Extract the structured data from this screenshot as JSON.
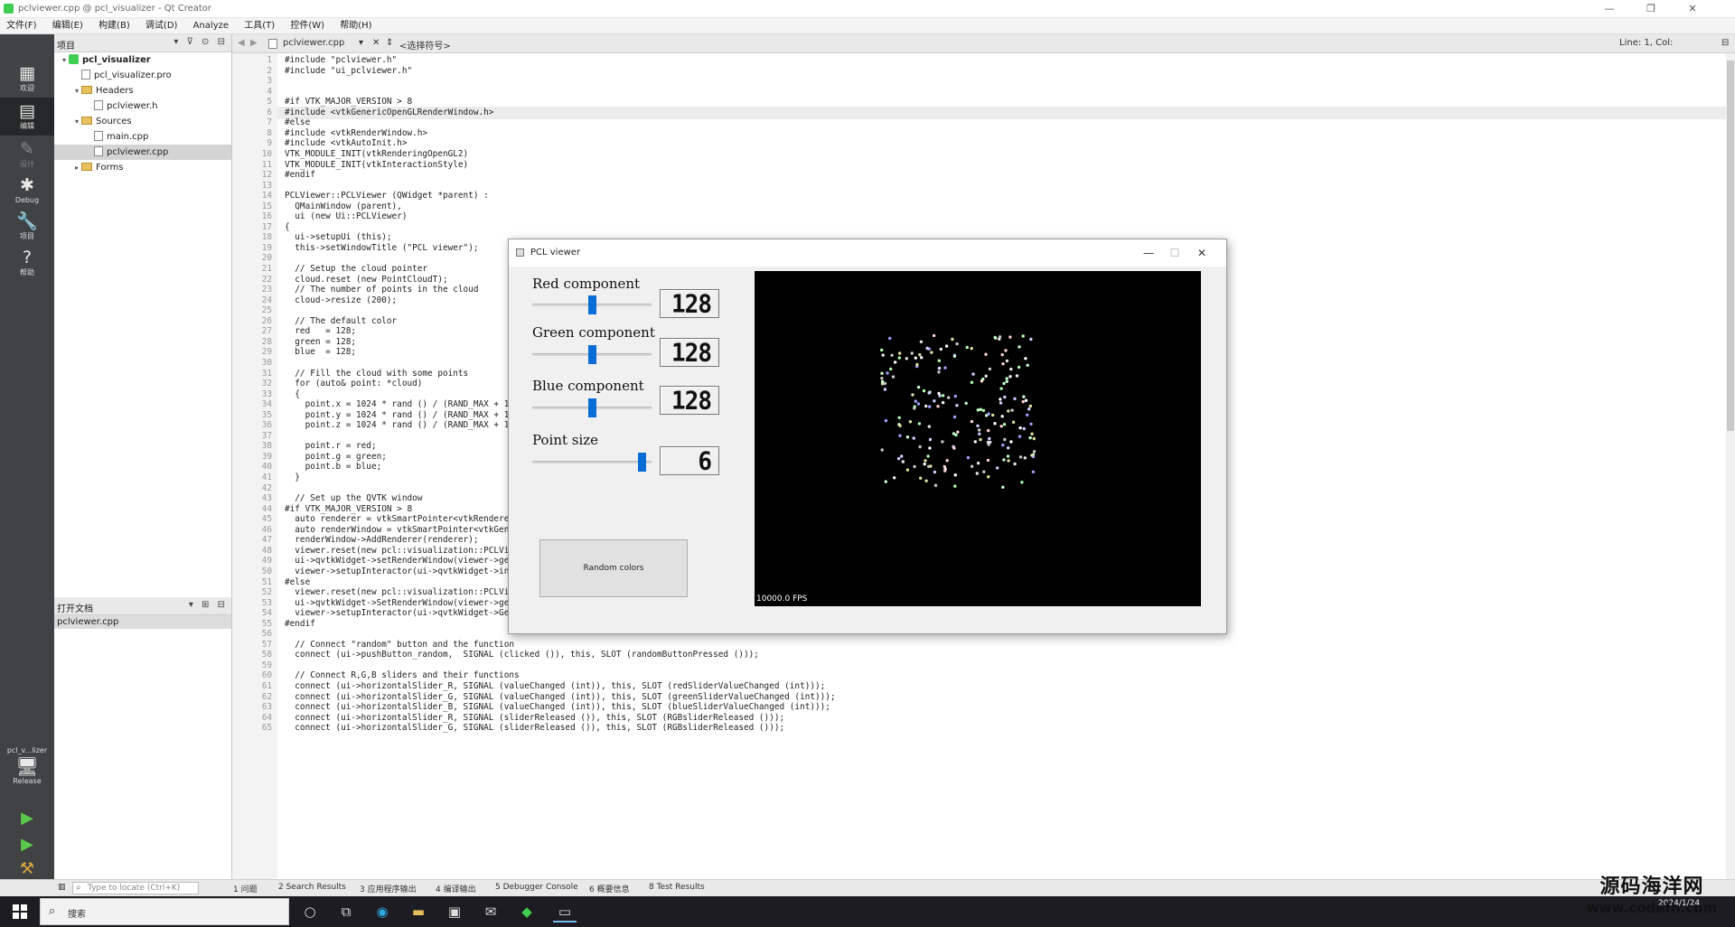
{
  "window": {
    "title": "pclviewer.cpp @ pcl_visualizer - Qt Creator",
    "controls": [
      "—",
      "❐",
      "✕"
    ]
  },
  "menu": [
    "文件(F)",
    "编辑(E)",
    "构建(B)",
    "调试(D)",
    "Analyze",
    "工具(T)",
    "控件(W)",
    "帮助(H)"
  ],
  "modes": [
    {
      "label": "欢迎",
      "icon": "welcome-icon"
    },
    {
      "label": "编辑",
      "icon": "edit-icon",
      "active": true
    },
    {
      "label": "设计",
      "icon": "design-icon",
      "dim": true
    },
    {
      "label": "Debug",
      "icon": "debug-icon"
    },
    {
      "label": "项目",
      "icon": "projects-icon"
    },
    {
      "label": "帮助",
      "icon": "help-icon"
    }
  ],
  "kit": {
    "project": "pcl_v...lizer",
    "config": "Release"
  },
  "project_panel": {
    "header": "项目",
    "tree": [
      {
        "label": "pcl_visualizer",
        "type": "project",
        "level": 0,
        "arrow": "▾"
      },
      {
        "label": "pcl_visualizer.pro",
        "type": "file",
        "level": 1,
        "arrow": ""
      },
      {
        "label": "Headers",
        "type": "folder",
        "level": 1,
        "arrow": "▾"
      },
      {
        "label": "pclviewer.h",
        "type": "file",
        "level": 2,
        "arrow": ""
      },
      {
        "label": "Sources",
        "type": "folder",
        "level": 1,
        "arrow": "▾"
      },
      {
        "label": "main.cpp",
        "type": "file",
        "level": 2,
        "arrow": ""
      },
      {
        "label": "pclviewer.cpp",
        "type": "file",
        "level": 2,
        "arrow": "",
        "selected": true
      },
      {
        "label": "Forms",
        "type": "folder",
        "level": 1,
        "arrow": "▸"
      }
    ]
  },
  "open_docs": {
    "header": "打开文档",
    "files": [
      "pclviewer.cpp"
    ]
  },
  "editor": {
    "file_tab": "pclviewer.cpp",
    "symbol": "<选择符号>",
    "position": "Line: 1, Col:",
    "lines": [
      "#include \"pclviewer.h\"",
      "#include \"ui_pclviewer.h\"",
      "",
      "",
      "#if VTK_MAJOR_VERSION > 8",
      "#include <vtkGenericOpenGLRenderWindow.h>",
      "#else",
      "#include <vtkRenderWindow.h>",
      "#include <vtkAutoInit.h>",
      "VTK_MODULE_INIT(vtkRenderingOpenGL2)",
      "VTK_MODULE_INIT(vtkInteractionStyle)",
      "#endif",
      "",
      "PCLViewer::PCLViewer (QWidget *parent) :",
      "  QMainWindow (parent),",
      "  ui (new Ui::PCLViewer)",
      "{",
      "  ui->setupUi (this);",
      "  this->setWindowTitle (\"PCL viewer\");",
      "",
      "  // Setup the cloud pointer",
      "  cloud.reset (new PointCloudT);",
      "  // The number of points in the cloud",
      "  cloud->resize (200);",
      "",
      "  // The default color",
      "  red   = 128;",
      "  green = 128;",
      "  blue  = 128;",
      "",
      "  // Fill the cloud with some points",
      "  for (auto& point: *cloud)",
      "  {",
      "    point.x = 1024 * rand () / (RAND_MAX + 1.0f);",
      "    point.y = 1024 * rand () / (RAND_MAX + 1.0f);",
      "    point.z = 1024 * rand () / (RAND_MAX + 1.0f);",
      "",
      "    point.r = red;",
      "    point.g = green;",
      "    point.b = blue;",
      "  }",
      "",
      "  // Set up the QVTK window",
      "#if VTK_MAJOR_VERSION > 8",
      "  auto renderer = vtkSmartPointer<vtkRenderer>::New();",
      "  auto renderWindow = vtkSmartPointer<vtkGenericOpenGLRenderWindow>::New();",
      "  renderWindow->AddRenderer(renderer);",
      "  viewer.reset(new pcl::visualization::PCLVisualizer(renderer, renderWindow, \"viewer\", false));",
      "  ui->qvtkWidget->setRenderWindow(viewer->getRenderWindow());",
      "  viewer->setupInteractor(ui->qvtkWidget->interactor(), ui->qvtkWidget->renderWindow());",
      "#else",
      "  viewer.reset(new pcl::visualization::PCLVisualizer(\"viewer\", false));",
      "  ui->qvtkWidget->SetRenderWindow(viewer->getRenderWindow());",
      "  viewer->setupInteractor(ui->qvtkWidget->GetInteractor(), ui->qvtkWidget->GetRenderWindow());",
      "#endif",
      "",
      "  // Connect \"random\" button and the function",
      "  connect (ui->pushButton_random,  SIGNAL (clicked ()), this, SLOT (randomButtonPressed ()));",
      "",
      "  // Connect R,G,B sliders and their functions",
      "  connect (ui->horizontalSlider_R, SIGNAL (valueChanged (int)), this, SLOT (redSliderValueChanged (int)));",
      "  connect (ui->horizontalSlider_G, SIGNAL (valueChanged (int)), this, SLOT (greenSliderValueChanged (int)));",
      "  connect (ui->horizontalSlider_B, SIGNAL (valueChanged (int)), this, SLOT (blueSliderValueChanged (int)));",
      "  connect (ui->horizontalSlider_R, SIGNAL (sliderReleased ()), this, SLOT (RGBsliderReleased ()));",
      "  connect (ui->horizontalSlider_G, SIGNAL (sliderReleased ()), this, SLOT (RGBsliderReleased ()));"
    ]
  },
  "status": {
    "locate_placeholder": "Type to locate (Ctrl+K)",
    "tabs": [
      "1 问题",
      "2 Search Results",
      "3 应用程序输出",
      "4 编译输出",
      "5 Debugger Console",
      "6 概要信息",
      "8 Test Results"
    ]
  },
  "pcl_window": {
    "title": "PCL viewer",
    "controls": [
      "—",
      "☐",
      "✕"
    ],
    "components": [
      {
        "label": "Red component",
        "value": "128",
        "fraction": 0.5
      },
      {
        "label": "Green component",
        "value": "128",
        "fraction": 0.5
      },
      {
        "label": "Blue component",
        "value": "128",
        "fraction": 0.5
      },
      {
        "label": "Point size",
        "value": "6",
        "fraction": 0.95
      }
    ],
    "button": "Random colors",
    "fps": "10000.0 FPS"
  },
  "taskbar": {
    "search": "搜索",
    "time": "",
    "date": "2024/1/24"
  },
  "watermark": {
    "cn": "源码海洋网",
    "url": "www.codefh.com"
  },
  "colors": {
    "accent": "#0a6cd6",
    "modebar": "#404244",
    "qt_green": "#41cd52"
  }
}
